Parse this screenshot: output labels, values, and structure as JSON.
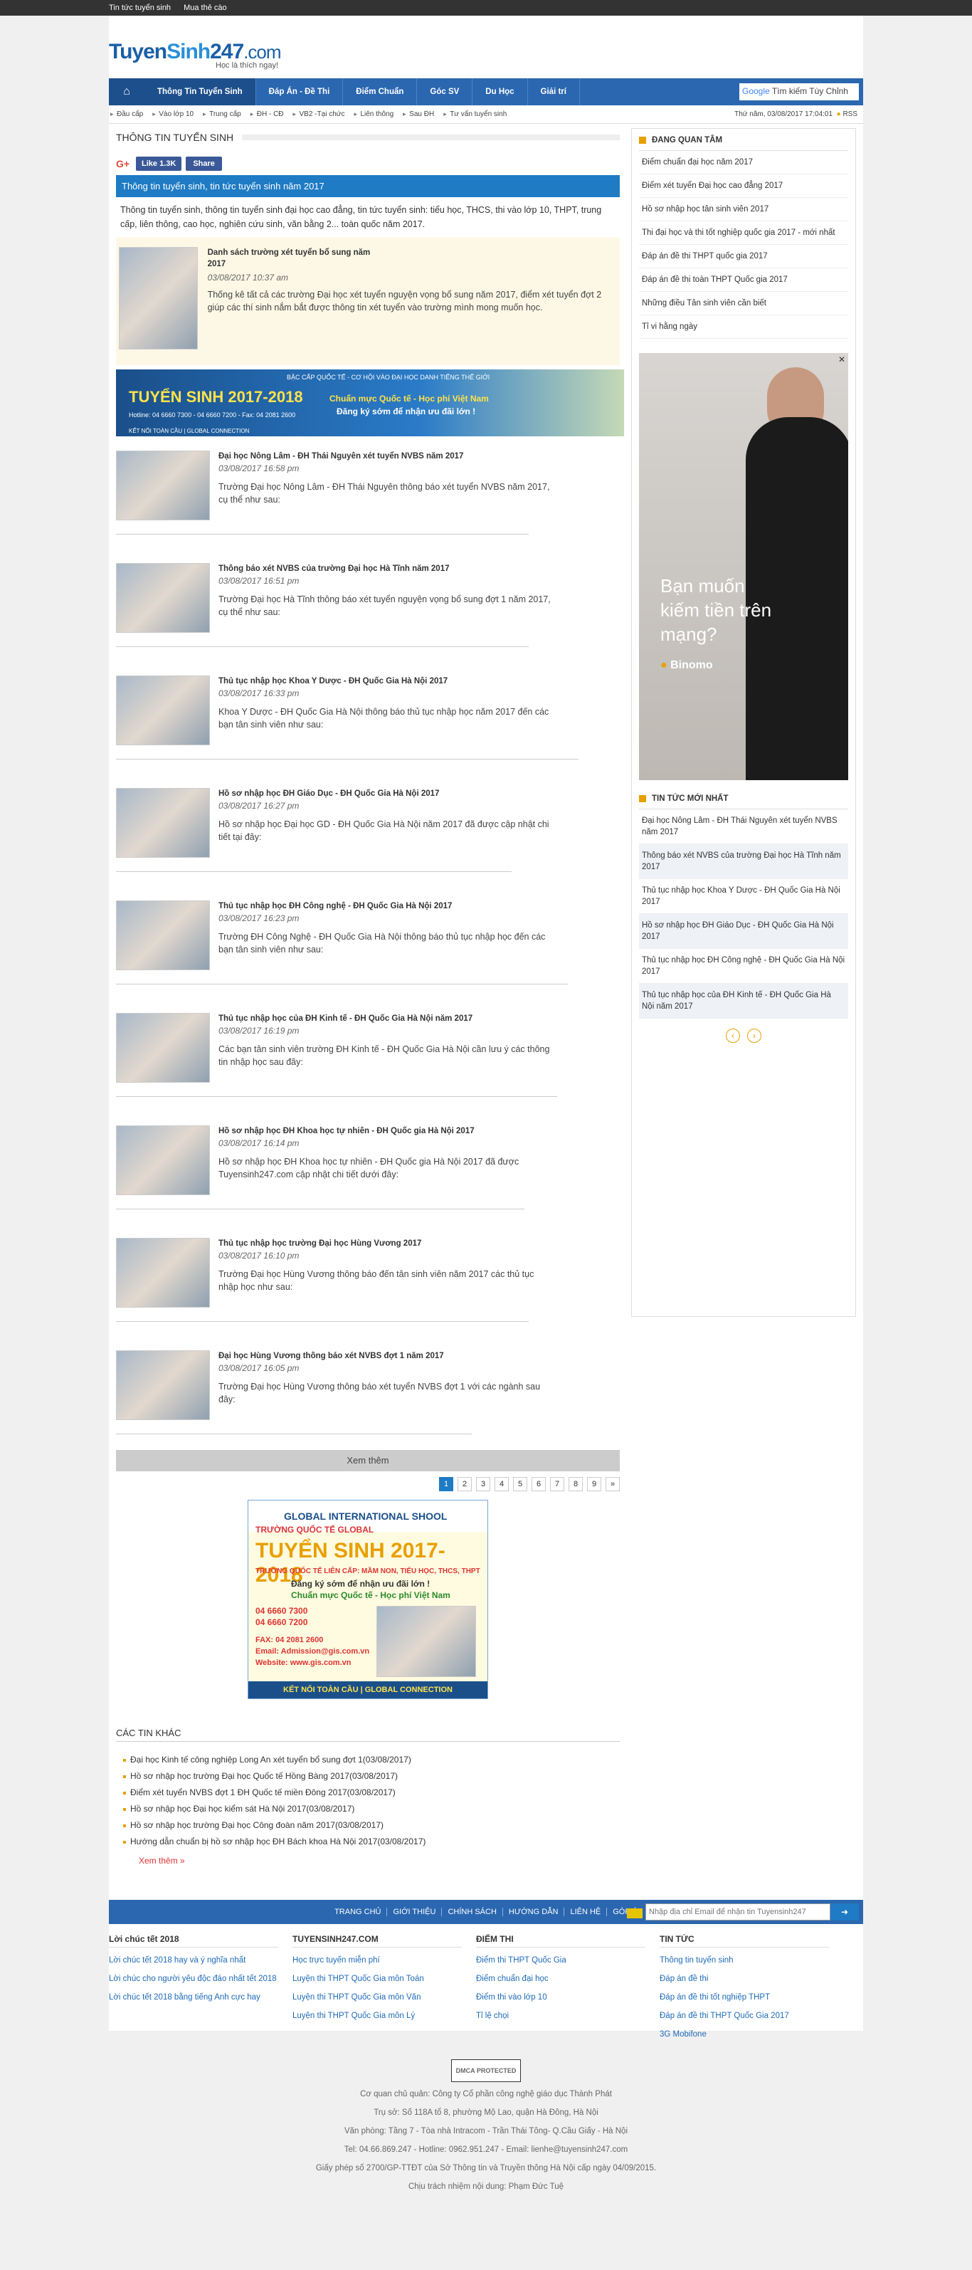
{
  "topbar": [
    "Tin tức tuyển sinh",
    "Mua thẻ cào"
  ],
  "logo": {
    "part1": "Tuyen",
    "part2": "Sinh",
    "part3": "247",
    "domain": ".com",
    "slogan": "Học là thích ngay!"
  },
  "nav": {
    "items": [
      "Thông Tin Tuyển Sinh",
      "Đáp Án - Đề Thi",
      "Điểm Chuẩn",
      "Góc SV",
      "Du Học",
      "Giải trí"
    ],
    "search_prefix": "Google",
    "search_placeholder": "Tìm kiếm Tùy Chỉnh"
  },
  "subnav": {
    "items": [
      "Đầu cấp",
      "Vào lớp 10",
      "Trung cấp",
      "ĐH - CĐ",
      "VB2 -Tại chức",
      "Liên thông",
      "Sau ĐH",
      "Tư vấn tuyển sinh"
    ],
    "datetime": "Thứ năm, 03/08/2017 17:04:01",
    "rss": "RSS"
  },
  "section_title": "THÔNG TIN TUYỂN SINH",
  "share": {
    "gplus": "G+",
    "like": "Like 1.3K",
    "share": "Share"
  },
  "page_head": "Thông tin tuyển sinh, tin tức tuyển sinh năm 2017",
  "intro": "Thông tin tuyển sinh, thông tin tuyển sinh đại học cao đẳng, tin tức tuyển sinh: tiểu học, THCS, thi vào lớp 10, THPT, trung cấp, liên thông, cao học, nghiên cứu sinh, văn bằng 2... toàn quốc năm 2017.",
  "featured": {
    "title": "Danh sách trường xét tuyển bổ sung năm 2017",
    "date": "03/08/2017 10:37 am",
    "summary": "Thống kê tất cả các trường Đại học xét tuyển nguyện vọng bổ sung năm 2017, điểm xét tuyển đợt 2 giúp các thí sinh nắm bắt được thông tin xét tuyển vào trường mình mong muốn học."
  },
  "banner": {
    "top": "BẬC CẤP QUỐC TẾ - CƠ HỘI VÀO ĐẠI HỌC DANH TIẾNG THẾ GIỚI",
    "title": "TUYỂN SINH 2017-2018",
    "slogan": "Chuẩn mực Quốc tế - Học phí Việt Nam",
    "cta": "Đăng ký sớm để nhận ưu đãi lớn !",
    "contact": "Hotline: 04 6660 7300 - 04 6660 7200 - Fax: 04 2081 2600",
    "bottom": "KẾT NỐI TOÀN CẦU | GLOBAL CONNECTION"
  },
  "news": [
    {
      "title": "Đại học Nông Lâm - ĐH Thái Nguyên xét tuyển NVBS năm 2017",
      "date": "03/08/2017 16:58 pm",
      "summary": "Trường Đại học Nông Lâm - ĐH Thái Nguyên thông báo xét tuyển NVBS năm 2017, cụ thể như sau:"
    },
    {
      "title": "Thông báo xét NVBS của trường Đại học Hà Tĩnh năm 2017",
      "date": "03/08/2017 16:51 pm",
      "summary": "Trường Đại học Hà Tĩnh thông báo xét tuyển nguyện vọng bổ sung đợt 1 năm 2017, cụ thể như sau:"
    },
    {
      "title": "Thủ tục nhập học Khoa Y Dược - ĐH Quốc Gia Hà Nội 2017",
      "date": "03/08/2017 16:33 pm",
      "summary": "Khoa Y Dược - ĐH Quốc Gia Hà Nội thông báo thủ tục nhập học năm 2017 đến các bạn tân sinh viên như sau:"
    },
    {
      "title": "Hồ sơ nhập học ĐH Giáo Dục - ĐH Quốc Gia Hà Nội 2017",
      "date": "03/08/2017 16:27 pm",
      "summary": "Hồ sơ nhập học Đại học GD - ĐH Quốc Gia Hà Nội năm 2017 đã được cập nhật chi tiết tại đây:"
    },
    {
      "title": "Thủ tục nhập học ĐH Công nghệ - ĐH Quốc Gia Hà Nội 2017",
      "date": "03/08/2017 16:23 pm",
      "summary": "Trường ĐH Công Nghệ - ĐH Quốc Gia Hà Nội thông báo thủ tục nhập học đến các bạn tân sinh viên như sau:"
    },
    {
      "title": "Thủ tục nhập học của ĐH Kinh tế - ĐH Quốc Gia Hà Nội năm 2017",
      "date": "03/08/2017 16:19 pm",
      "summary": "Các bạn tân sinh viên trường ĐH Kinh tế - ĐH Quốc Gia Hà Nội cần lưu ý các thông tin nhập học sau đây:"
    },
    {
      "title": "Hồ sơ nhập học ĐH Khoa học tự nhiên - ĐH Quốc gia Hà Nội 2017",
      "date": "03/08/2017 16:14 pm",
      "summary": "Hồ sơ nhập học ĐH Khoa học tự nhiên - ĐH Quốc gia Hà Nội 2017 đã được Tuyensinh247.com cập nhật chi tiết dưới đây:"
    },
    {
      "title": "Thủ tục nhập học trường Đại học Hùng Vương 2017",
      "date": "03/08/2017 16:10 pm",
      "summary": "Trường Đại học Hùng Vương thông báo đến tân sinh viên năm 2017 các thủ tục nhập học như sau:"
    },
    {
      "title": "Đại học Hùng Vương thông báo xét NVBS đợt 1 năm 2017",
      "date": "03/08/2017 16:05 pm",
      "summary": "Trường Đại học Hùng Vương thông báo xét tuyển NVBS đợt 1 với các ngành sau đây:"
    }
  ],
  "more_label": "Xem thêm",
  "pager": [
    "1",
    "2",
    "3",
    "4",
    "5",
    "6",
    "7",
    "8",
    "9",
    "»"
  ],
  "ad2": {
    "school": "GLOBAL INTERNATIONAL SHOOL",
    "school_vi": "TRƯỜNG QUỐC TẾ GLOBAL",
    "title": "TUYỂN SINH 2017-2018",
    "levels": "TRƯỜNG QUỐC TẾ LIÊN CẤP: MẦM NON, TIỂU HỌC, THCS, THPT",
    "cta": "Đăng ký sớm để nhận ưu đãi lớn !",
    "slogan": "Chuẩn mực Quốc tế - Học phí Việt Nam",
    "tel1": "04 6660 7300",
    "tel2": "04 6660 7200",
    "fax": "FAX: 04 2081 2600",
    "email": "Email: Admission@gis.com.vn",
    "web": "Website: www.gis.com.vn",
    "bottom": "KẾT NỐI TOÀN CẦU | GLOBAL CONNECTION"
  },
  "other": {
    "title": "CÁC TIN KHÁC",
    "items": [
      "Đại học Kinh tế công nghiệp Long An xét tuyển bổ sung đợt 1(03/08/2017)",
      "Hồ sơ nhập học trường Đại học Quốc tế Hồng Bàng 2017(03/08/2017)",
      "Điểm xét tuyển NVBS đợt 1 ĐH Quốc tế miền Đông 2017(03/08/2017)",
      "Hồ sơ nhập học Đại học kiểm sát Hà Nội 2017(03/08/2017)",
      "Hồ sơ nhập học trường Đại học Công đoàn năm 2017(03/08/2017)",
      "Hướng dẫn chuẩn bị hồ sơ nhập học ĐH Bách khoa Hà Nội 2017(03/08/2017)"
    ],
    "more": "Xem thêm »"
  },
  "sidebar": {
    "hot_title": "ĐANG QUAN TÂM",
    "hot": [
      "Điểm chuẩn đại học năm 2017",
      "Điểm xét tuyển Đại học cao đẳng 2017",
      "Hồ sơ nhập học tân sinh viên 2017",
      "Thi đại học và thi tốt nghiệp quốc gia 2017 - mới nhất",
      "Đáp án đề thi THPT quốc gia 2017",
      "Đáp án đề thi toàn THPT Quốc gia 2017",
      "Những điều Tân sinh viên cần biết",
      "Tỉ vi hằng ngày"
    ],
    "ad_text": "Bạn muốn kiếm tiền trên mạng?",
    "ad_brand": "Binomo",
    "latest_title": "TIN TỨC MỚI NHẤT",
    "latest": [
      "Đại học Nông Lâm - ĐH Thái Nguyên xét tuyển NVBS năm 2017",
      "Thông báo xét NVBS của trường Đại học Hà Tĩnh năm 2017",
      "Thủ tục nhập học Khoa Y Dược - ĐH Quốc Gia Hà Nội 2017",
      "Hồ sơ nhập học ĐH Giáo Dục - ĐH Quốc Gia Hà Nội 2017",
      "Thủ tục nhập học ĐH Công nghệ - ĐH Quốc Gia Hà Nội 2017",
      "Thủ tục nhập học của ĐH Kinh tế - ĐH Quốc Gia Hà Nội năm 2017"
    ]
  },
  "footer": {
    "nav": [
      "TRANG CHỦ",
      "GIỚI THIỆU",
      "CHÍNH SÁCH",
      "HƯỚNG DẪN",
      "LIÊN HỆ",
      "GÓP Ý"
    ],
    "newsletter_placeholder": "Nhập địa chỉ Email để nhận tin Tuyensinh247",
    "cols": [
      {
        "title": "Lời chúc tết 2018",
        "items": [
          "Lời chúc tết 2018 hay và ý nghĩa nhất",
          "Lời chúc cho người yêu độc đáo nhất tết 2018",
          "Lời chúc tết 2018 bằng tiếng Anh cực hay"
        ]
      },
      {
        "title": "TUYENSINH247.COM",
        "items": [
          "Học trực tuyến miễn phí",
          "Luyện thi THPT Quốc Gia môn Toán",
          "Luyện thi THPT Quốc Gia môn Văn",
          "Luyện thi THPT Quốc Gia môn Lý"
        ]
      },
      {
        "title": "ĐIỂM THI",
        "items": [
          "Điểm thi THPT Quốc Gia",
          "Điểm chuẩn đại học",
          "Điểm thi vào lớp 10",
          "Tỉ lệ chọi"
        ]
      },
      {
        "title": "TIN TỨC",
        "items": [
          "Thông tin tuyển sinh",
          "Đáp án đề thi",
          "Đáp án đề thi tốt nghiệp THPT",
          "Đáp án đề thi THPT Quốc Gia 2017",
          "3G Mobifone"
        ]
      }
    ],
    "dmca": "DMCA PROTECTED",
    "lines": [
      "Cơ quan chủ quản: Công ty Cổ phần công nghệ giáo dục Thành Phát",
      "Trụ sở: Số 118A tổ 8, phường Mộ Lao, quận Hà Đông, Hà Nội",
      "Văn phòng: Tầng 7 - Tòa nhà Intracom - Trần Thái Tông- Q.Cầu Giấy - Hà Nội",
      "Tel: 04.66.869.247 - Hotline: 0962.951.247 - Email: lienhe@tuyensinh247.com",
      "Giấy phép số 2700/GP-TTĐT của Sở Thông tin và Truyền thông Hà Nội cấp ngày 04/09/2015.",
      "Chịu trách nhiệm nội dung: Phạm Đức Tuệ"
    ]
  }
}
